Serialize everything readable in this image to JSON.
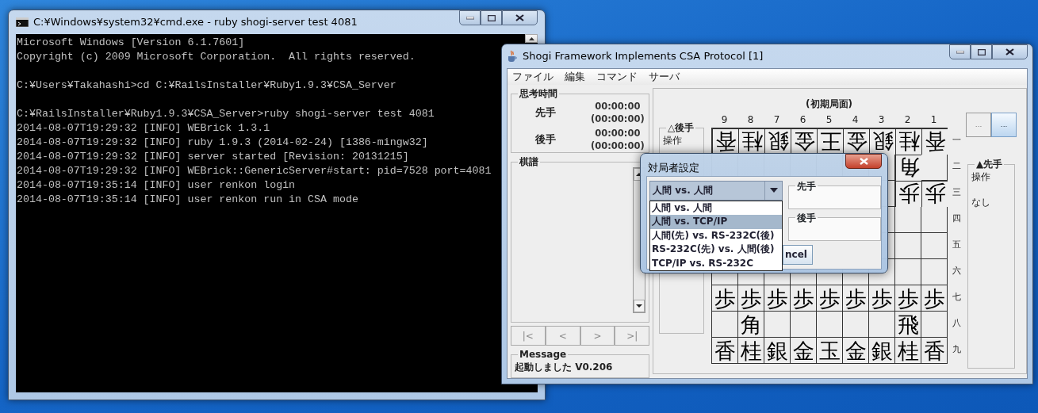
{
  "console_window": {
    "title": "C:¥Windows¥system32¥cmd.exe - ruby  shogi-server test 4081",
    "blocks": [
      [
        "Microsoft Windows [Version 6.1.7601]",
        "Copyright (c) 2009 Microsoft Corporation.  All rights reserved."
      ],
      [
        "C:¥Users¥Takahashi>cd C:¥RailsInstaller¥Ruby1.9.3¥CSA_Server"
      ],
      [
        "C:¥RailsInstaller¥Ruby1.9.3¥CSA_Server>ruby shogi-server test 4081",
        "2014-08-07T19:29:32 [INFO] WEBrick 1.3.1",
        "2014-08-07T19:29:32 [INFO] ruby 1.9.3 (2014-02-24) [i386-mingw32]",
        "2014-08-07T19:29:32 [INFO] server started [Revision: 20131215]",
        "2014-08-07T19:29:32 [INFO] WEBrick::GenericServer#start: pid=7528 port=4081",
        "2014-08-07T19:35:14 [INFO] user renkon login",
        "2014-08-07T19:35:14 [INFO] user renkon run in CSA mode"
      ]
    ]
  },
  "shogi_window": {
    "title": "Shogi Framework Implements CSA Protocol [1]",
    "menu": [
      "ファイル",
      "編集",
      "コマンド",
      "サーバ"
    ],
    "time_panel": {
      "title": "思考時間",
      "players": [
        {
          "label": "先手",
          "time": "00:00:00",
          "total": "(00:00:00)"
        },
        {
          "label": "後手",
          "time": "00:00:00",
          "total": "(00:00:00)"
        }
      ]
    },
    "kifu_panel": {
      "title": "棋譜"
    },
    "nav_buttons": [
      {
        "label": "|<",
        "disabled": true
      },
      {
        "label": "<",
        "disabled": true
      },
      {
        "label": ">",
        "disabled": true
      },
      {
        "label": ">|",
        "disabled": true
      }
    ],
    "message_panel": {
      "title": "Message",
      "text": "起動しました V0.206"
    },
    "gote_panel": {
      "title": "△後手",
      "label": "操作"
    },
    "board": {
      "title": "(初期局面)",
      "column_labels": [
        "9",
        "8",
        "7",
        "6",
        "5",
        "4",
        "3",
        "2",
        "1"
      ],
      "row_labels": [
        "一",
        "二",
        "三",
        "四",
        "五",
        "六",
        "七",
        "八",
        "九"
      ],
      "rows": [
        [
          {
            "piece": "香",
            "inverted": true
          },
          {
            "piece": "桂",
            "inverted": true
          },
          {
            "piece": "銀",
            "inverted": true
          },
          {
            "piece": "金",
            "inverted": true
          },
          {
            "piece": "王",
            "inverted": true
          },
          {
            "piece": "金",
            "inverted": true
          },
          {
            "piece": "銀",
            "inverted": true
          },
          {
            "piece": "桂",
            "inverted": true
          },
          {
            "piece": "香",
            "inverted": true
          }
        ],
        [
          null,
          null,
          null,
          null,
          null,
          null,
          null,
          {
            "piece": "角",
            "inverted": true
          },
          null
        ],
        [
          null,
          null,
          null,
          null,
          null,
          null,
          null,
          {
            "piece": "歩",
            "inverted": true
          },
          {
            "piece": "歩",
            "inverted": true
          }
        ],
        [
          null,
          null,
          null,
          null,
          null,
          null,
          null,
          null,
          null
        ],
        [
          null,
          null,
          null,
          null,
          null,
          null,
          null,
          null,
          null
        ],
        [
          null,
          null,
          null,
          null,
          null,
          null,
          null,
          null,
          null
        ],
        [
          {
            "piece": "歩",
            "inverted": false
          },
          {
            "piece": "歩",
            "inverted": false
          },
          {
            "piece": "歩",
            "inverted": false
          },
          {
            "piece": "歩",
            "inverted": false
          },
          {
            "piece": "歩",
            "inverted": false
          },
          {
            "piece": "歩",
            "inverted": false
          },
          {
            "piece": "歩",
            "inverted": false
          },
          {
            "piece": "歩",
            "inverted": false
          },
          {
            "piece": "歩",
            "inverted": false
          }
        ],
        [
          null,
          {
            "piece": "角",
            "inverted": false
          },
          null,
          null,
          null,
          null,
          null,
          {
            "piece": "飛",
            "inverted": false
          },
          null
        ],
        [
          {
            "piece": "香",
            "inverted": false
          },
          {
            "piece": "桂",
            "inverted": false
          },
          {
            "piece": "銀",
            "inverted": false
          },
          {
            "piece": "金",
            "inverted": false
          },
          {
            "piece": "玉",
            "inverted": false
          },
          {
            "piece": "金",
            "inverted": false
          },
          {
            "piece": "銀",
            "inverted": false
          },
          {
            "piece": "桂",
            "inverted": false
          },
          {
            "piece": "香",
            "inverted": false
          }
        ]
      ]
    },
    "side_buttons": [
      {
        "label": "...",
        "selected": false
      },
      {
        "label": "...",
        "selected": true
      }
    ],
    "sente_panel": {
      "title": "▲先手",
      "label": "操作",
      "value": "なし"
    }
  },
  "dialog": {
    "title": "対局者設定",
    "combo": {
      "value": "人間 vs. 人間"
    },
    "options": [
      {
        "label": "人間 vs. 人間",
        "selected": false
      },
      {
        "label": "人間 vs. TCP/IP",
        "selected": true
      },
      {
        "label": "人間(先) vs. RS-232C(後)",
        "selected": false
      },
      {
        "label": "RS-232C(先) vs. 人間(後)",
        "selected": false
      },
      {
        "label": "TCP/IP vs. RS-232C",
        "selected": false
      }
    ],
    "groups": [
      "先手",
      "後手"
    ],
    "button": "ncel"
  }
}
